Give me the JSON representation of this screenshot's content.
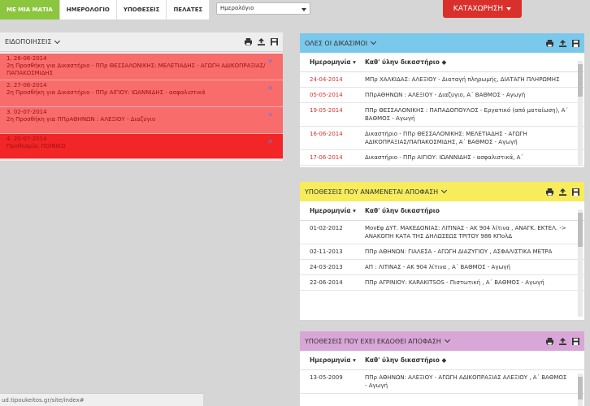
{
  "topnav": {
    "tabs": [
      "ΜΕ ΜΙΑ ΜΑΤΙΑ",
      "ΗΜΕΡΟΛΟΓΙΟ",
      "ΥΠΟΘΕΣΕΙΣ",
      "ΠΕΛΑΤΕΣ"
    ],
    "select_value": "Ημερολόγιο",
    "register_label": "ΚΑΤΑΧΩΡΗΣΗ"
  },
  "notifications": {
    "title": "ΕΙΔΟΠΟΙΗΣΕΙΣ",
    "items": [
      {
        "line1": "1. 26-06-2014",
        "line2": "2η Προσθήκη για Δικαστήριο - ΠΠρ ΘΕΣΣΑΛΟΝΙΚΗΣ: ΜΕΛΕΤΙΑΔΗΣ - ΑΓΩΓΗ ΑΔΙΚΟΠΡΑΞΙΑΣ/ΠΑΠΑΚΟΣΜΙΔΗΣ"
      },
      {
        "line1": "2. 27-06-2014",
        "line2": "2η Προσθήκη για Δικαστήριο - ΠΠρ ΑΙΓΙΟΥ: ΙΩΑΝΝΙΔΗΣ - ασφαλιστικά"
      },
      {
        "line1": "3. 02-07-2014",
        "line2": "2η Προσθήκη για ΠΠρΑΘΗΝΩΝ : ΑΛΕΞΙΟΥ - Διαζυγιο"
      },
      {
        "line1": "4. 20-07-2014",
        "line2": "Προθεσμία: ΠΟΙΝΙΚΟ"
      }
    ]
  },
  "panel_trials": {
    "title": "ΟΛΕΣ ΟΙ ΔΙΚΑΣΙΜΟΙ",
    "col_date": "Ημερομηνία",
    "col_court": "Καθ' ύλην δικαστήριο",
    "rows": [
      {
        "date": "24-04-2014",
        "text": "ΜΠρ ΧΑΛΚΙΔΑΣ: ΑΛΕΞΙΟΥ - Διαταγή πληρωμής, ΔΙΑΤΑΓΗ ΠΛΗΡΩΜΗΣ"
      },
      {
        "date": "05-05-2014",
        "text": "ΠΠρΑΘΗΝΩΝ : ΑΛΕΞΙΟΥ - Διαζυγιο, Α΄ ΒΑΘΜΟΣ - Αγωγή"
      },
      {
        "date": "19-05-2014",
        "text": "ΠΠρ ΘΕΣΣΑΛΟΝΙΚΗΣ : ΠΑΠΑΔΟΠΟΥΛΟΣ - Εργατικό (από ματαίωση), Α΄ ΒΑΘΜΟΣ - Αγωγή"
      },
      {
        "date": "16-06-2014",
        "text": "Δικαστήριο - ΠΠρ ΘΕΣΣΑΛΟΝΙΚΗΣ: ΜΕΛΕΤΙΑΔΗΣ - ΑΓΩΓΗ ΑΔΙΚΟΠΡΑΞΙΑΣ/ΠΑΠΑΚΟΣΜΙΔΗΣ, Α΄ ΒΑΘΜΟΣ - Αγωγή"
      },
      {
        "date": "17-06-2014",
        "text": "Δικαστήριο - ΠΠρ ΑΙΓΙΟΥ: ΙΩΑΝΝΙΔΗΣ - ασφαλιστικά, Α΄"
      }
    ]
  },
  "panel_pending": {
    "title": "ΥΠΟΘΕΣΕΙΣ ΠΟΥ ΑΝΑΜΕΝΕΤΑΙ ΑΠΟΦΑΣΗ",
    "col_date": "Ημερομηνία",
    "col_court": "Καθ' ύλην δικαστήριο",
    "rows": [
      {
        "date": "01-02-2012",
        "text": "ΜονΕφ ΔΥΤ. ΜΑΚΕΔΟΝΙΑΣ: ΛΙΤΙΝΑΣ - ΑΚ 904 λίτινα , ΑΝΑΓΚ. ΕΚΤΕΛ. -> ΑΝΑΚΟΠΗ ΚΑΤΑ ΤΗΣ ΔΗΛΩΣΕΩΣ ΤΡΙΤΟΥ 986 ΚΠολΔ"
      },
      {
        "date": "02-11-2013",
        "text": "ΠΠρ ΑΘΗΝΩΝ: ΓΙΑΛΕΣΑ - ΑΓΩΓΗ ΔΙΑΖΥΓΙΟΥ , ΑΣΦΑΛΙΣΤΙΚΑ ΜΕΤΡΑ"
      },
      {
        "date": "24-03-2013",
        "text": "ΑΠ : ΛΙΤΙΝΑΣ - ΑΚ 904 λίτινα , Α΄ ΒΑΘΜΟΣ - Αγωγή"
      },
      {
        "date": "22-06-2014",
        "text": "ΠΠρ ΑΓΡΙΝΙΟΥ: KARAKITSOS - Πιστωτική , Α΄ ΒΑΘΜΟΣ - Αγωγή"
      }
    ]
  },
  "panel_decided": {
    "title": "ΥΠΟΘΕΣΕΙΣ ΠΟΥ ΕΧΕΙ ΕΚΔΟΘΕΙ ΑΠΟΦΑΣΗ",
    "col_date": "Ημερομηνία",
    "col_court": "Καθ' ύλην δικαστήριο",
    "rows": [
      {
        "date": "13-05-2009",
        "text": "ΠΠρ ΑΘΗΝΩΝ: ΑΛΕΞΙΟΥ - ΑΓΩΓΗ ΑΔΙΚΟΠΡΑΞΙΑΣ ΑΛΕΞΙΟΥ , Α΄ ΒΑΘΜΟΣ - Αγωγή"
      }
    ]
  },
  "statusbar": {
    "url": "ud.tipoukeitos.gr/site/index#"
  }
}
